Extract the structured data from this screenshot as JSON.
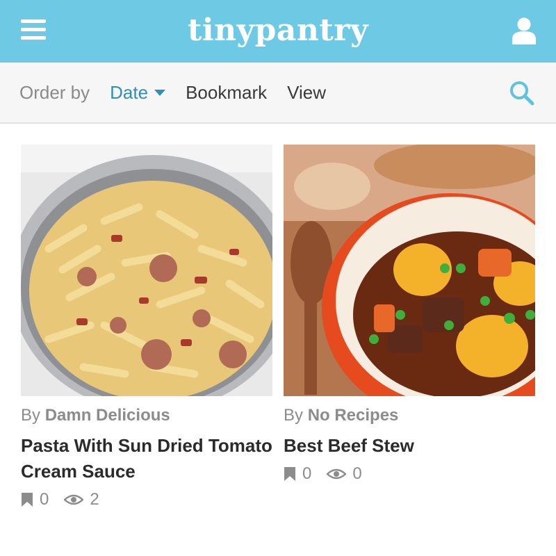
{
  "header": {
    "logo": "tinypantry",
    "menu_icon": "hamburger-menu-icon",
    "user_icon": "user-icon",
    "bg_color": "#6ecae4"
  },
  "filter": {
    "order_label": "Order by",
    "options": [
      "Date",
      "Bookmark",
      "View"
    ],
    "selected": "Date",
    "accent_color": "#2f90b4",
    "search_icon": "search-icon"
  },
  "recipes": [
    {
      "by": "By",
      "author": "Damn Delicious",
      "title": "Pasta With Sun Dried Tomato Cream Sauce",
      "bookmarks": "0",
      "views": "2"
    },
    {
      "by": "By",
      "author": "No Recipes",
      "title": "Best Beef Stew",
      "bookmarks": "0",
      "views": "0"
    }
  ]
}
